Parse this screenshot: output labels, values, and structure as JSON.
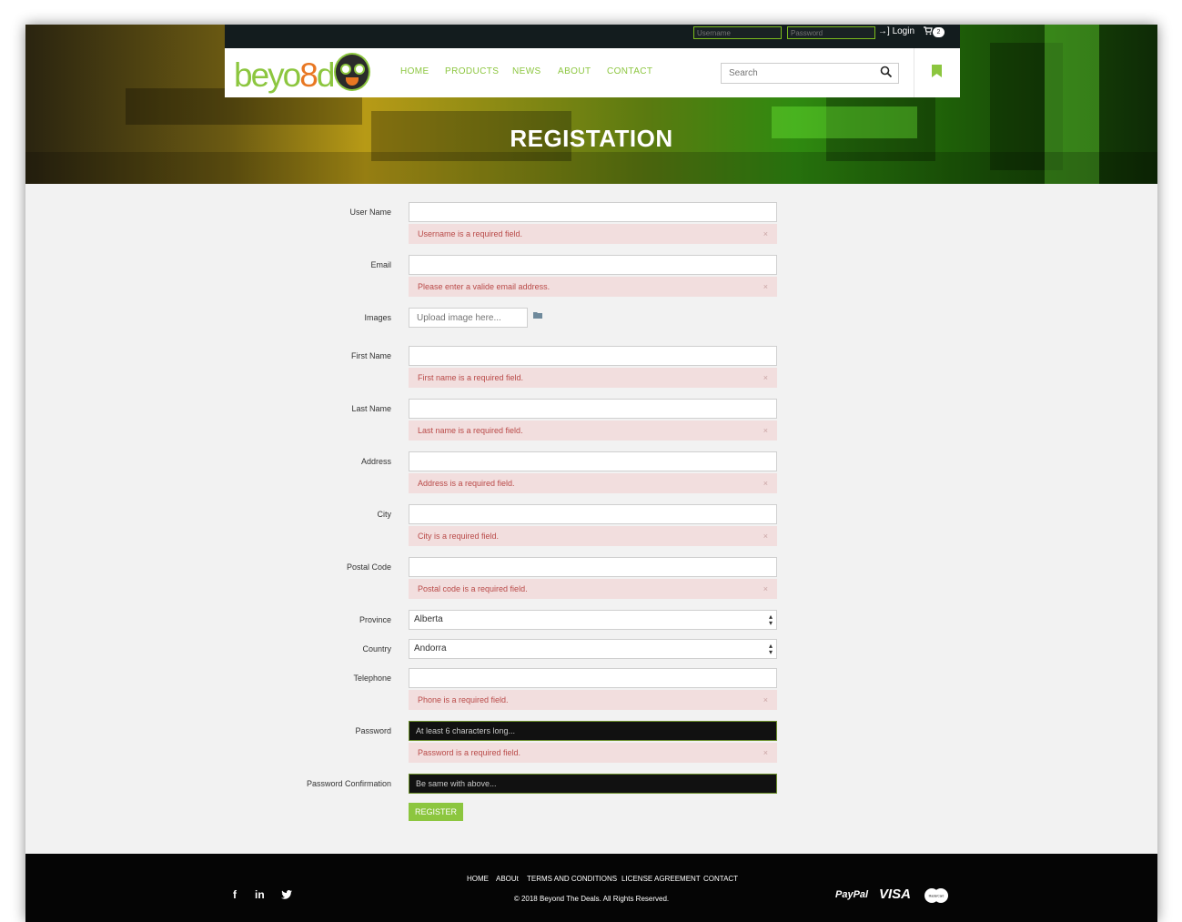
{
  "header": {
    "username_placeholder": "Username",
    "password_placeholder": "Password",
    "login_label": "Login",
    "cart_count": "2",
    "login_icon": "sign-in-icon",
    "cart_icon": "shopping-cart-icon"
  },
  "brand": {
    "logo_prefix": "beyo",
    "logo_mid": "8",
    "logo_suffix": "d"
  },
  "nav": {
    "items": [
      "HOME",
      "PRODUCTS",
      "NEWS",
      "ABOUT",
      "CONTACT"
    ],
    "search_placeholder": "Search",
    "search_icon": "search-icon",
    "bookmark_icon": "bookmark-icon"
  },
  "page": {
    "title": "REGISTATION"
  },
  "form": {
    "username": {
      "label": "User Name",
      "value": "",
      "error": "Username is a required field."
    },
    "email": {
      "label": "Email",
      "value": "",
      "error": "Please enter a valide email address."
    },
    "images": {
      "label": "Images",
      "placeholder": "Upload image here...",
      "icon": "folder-icon"
    },
    "first_name": {
      "label": "First Name",
      "value": "",
      "error": "First name is a required field."
    },
    "last_name": {
      "label": "Last Name",
      "value": "",
      "error": "Last name is a required field."
    },
    "address": {
      "label": "Address",
      "value": "",
      "error": "Address is a required field."
    },
    "city": {
      "label": "City",
      "value": "",
      "error": "City is a required field."
    },
    "postal_code": {
      "label": "Postal Code",
      "value": "",
      "error": "Postal code is a required field."
    },
    "province": {
      "label": "Province",
      "value": "Alberta"
    },
    "country": {
      "label": "Country",
      "value": "Andorra"
    },
    "telephone": {
      "label": "Telephone",
      "value": "",
      "error": "Phone is a required field."
    },
    "password": {
      "label": "Password",
      "placeholder": "At least 6 characters long...",
      "error": "Password is a required field."
    },
    "password_confirmation": {
      "label": "Password Confirmation",
      "placeholder": "Be same with above..."
    },
    "dismiss_glyph": "×",
    "submit_label": "REGISTER"
  },
  "footer": {
    "links": [
      "HOME",
      "ABOUt",
      "TERMS AND CONDITIONS",
      "LICENSE AGREEMENT",
      "CONTACT"
    ],
    "copyright": "© 2018 Beyond The Deals. All Rights Reserved.",
    "social": [
      "f",
      "in",
      "twitter-icon"
    ],
    "payments": [
      "PayPal",
      "VISA",
      "MasterCard"
    ]
  },
  "colors": {
    "accent": "#8cc63f",
    "error_bg": "#f2dede",
    "error_text": "#b94a48",
    "footer_bg": "#050505",
    "topbar_bg": "#131c1e"
  }
}
